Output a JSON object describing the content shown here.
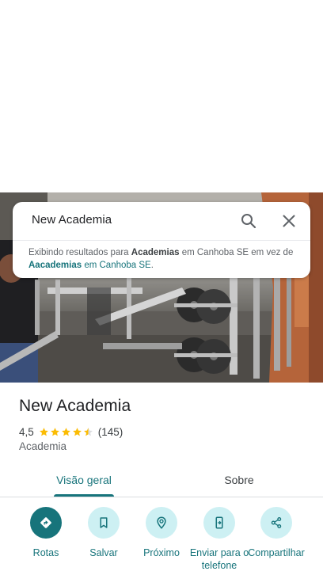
{
  "search": {
    "query": "New Academia",
    "note_prefix": "Exibindo resultados para ",
    "note_term": "Academias",
    "note_middle": " em Canhoba SE em vez de ",
    "note_original_term": "Aacademias",
    "note_original_rest": " em Canhoba SE",
    "note_suffix": "."
  },
  "place": {
    "name": "New Academia",
    "rating": "4,5",
    "stars": 4.5,
    "review_count": "(145)",
    "category": "Academia"
  },
  "tabs": [
    {
      "label": "Visão geral",
      "selected": true
    },
    {
      "label": "Sobre",
      "selected": false
    }
  ],
  "actions": [
    {
      "label": "Rotas",
      "icon": "directions-icon"
    },
    {
      "label": "Salvar",
      "icon": "bookmark-icon"
    },
    {
      "label": "Próximo",
      "icon": "nearby-icon"
    },
    {
      "label": "Enviar para o telefone",
      "icon": "send-to-phone-icon"
    },
    {
      "label": "Compartilhar",
      "icon": "share-icon"
    }
  ],
  "colors": {
    "accent": "#17747b",
    "accent_light": "#cdf0f3",
    "star": "#fbbc04"
  }
}
